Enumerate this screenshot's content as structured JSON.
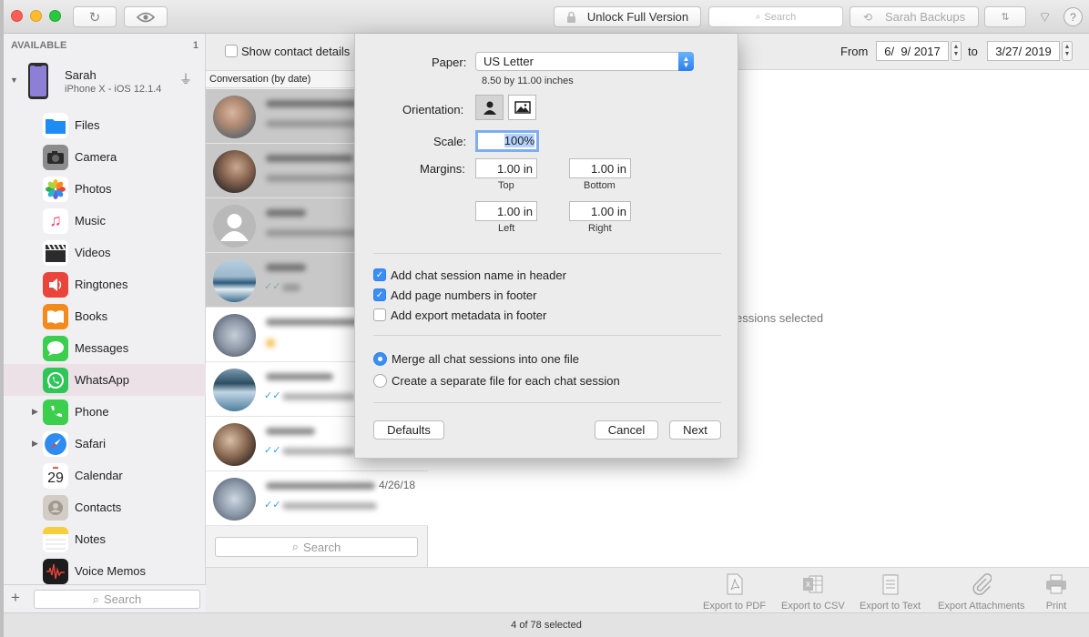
{
  "toolbar": {
    "unlock_label": "Unlock Full Version",
    "search_placeholder": "Search",
    "backups_label": "Sarah Backups",
    "help_label": "?"
  },
  "sidebar": {
    "header": "AVAILABLE",
    "count": "1",
    "device_name": "Sarah",
    "device_model": "iPhone X - iOS 12.1.4",
    "items": [
      {
        "label": "Files",
        "icon": "folder-icon",
        "color": "#1e8cf5"
      },
      {
        "label": "Camera",
        "icon": "camera-icon",
        "color": "#595959"
      },
      {
        "label": "Photos",
        "icon": "photos-icon",
        "color": "#ffffff"
      },
      {
        "label": "Music",
        "icon": "music-icon",
        "color": "#ffffff"
      },
      {
        "label": "Videos",
        "icon": "clapper-icon",
        "color": "#2b2b2b"
      },
      {
        "label": "Ringtones",
        "icon": "speaker-icon",
        "color": "#e9453a"
      },
      {
        "label": "Books",
        "icon": "book-icon",
        "color": "#f28a1c"
      },
      {
        "label": "Messages",
        "icon": "message-bubble-icon",
        "color": "#3ccf4e"
      },
      {
        "label": "WhatsApp",
        "icon": "whatsapp-icon",
        "color": "#2fc658"
      },
      {
        "label": "Phone",
        "icon": "phone-icon",
        "color": "#3ccf4e"
      },
      {
        "label": "Safari",
        "icon": "compass-icon",
        "color": "#2e8cf0"
      },
      {
        "label": "Calendar",
        "icon": "calendar-icon",
        "color": "#ffffff"
      },
      {
        "label": "Contacts",
        "icon": "contacts-icon",
        "color": "#c8c3bd"
      },
      {
        "label": "Notes",
        "icon": "notes-icon",
        "color": "#f8cf3b"
      },
      {
        "label": "Voice Memos",
        "icon": "waveform-icon",
        "color": "#1c1c1c"
      }
    ],
    "calendar_day": "29",
    "search_placeholder": "Search"
  },
  "conversations": {
    "show_details_label": "Show contact details",
    "column_header": "Conversation (by date)",
    "last_date": "4/26/18",
    "search_placeholder": "Search"
  },
  "main": {
    "from_label": "From",
    "from_date": "6/  9/ 2017",
    "to_label": "to",
    "to_date": "3/27/ 2019",
    "sessions_text": "essions selected"
  },
  "dialog": {
    "paper_label": "Paper:",
    "paper_value": "US Letter",
    "paper_size": "8.50 by 11.00 inches",
    "orientation_label": "Orientation:",
    "scale_label": "Scale:",
    "scale_value": "100%",
    "margins_label": "Margins:",
    "margin_top": "1.00 in",
    "margin_bottom": "1.00 in",
    "margin_left": "1.00 in",
    "margin_right": "1.00 in",
    "top_label": "Top",
    "bottom_label": "Bottom",
    "left_label": "Left",
    "right_label": "Right",
    "opt_header": "Add chat session name in header",
    "opt_page_numbers": "Add page numbers in footer",
    "opt_metadata": "Add export metadata in footer",
    "radio_merge": "Merge all chat sessions into one file",
    "radio_separate": "Create a separate file for each chat session",
    "defaults_label": "Defaults",
    "cancel_label": "Cancel",
    "next_label": "Next"
  },
  "bottombar": {
    "export_pdf": "Export to PDF",
    "export_csv": "Export to CSV",
    "export_text": "Export to Text",
    "export_attachments": "Export Attachments",
    "print": "Print"
  },
  "status": {
    "text": "4 of 78 selected"
  },
  "colors": {
    "accent": "#3b8ef5",
    "selection": "#ebe1e6"
  }
}
